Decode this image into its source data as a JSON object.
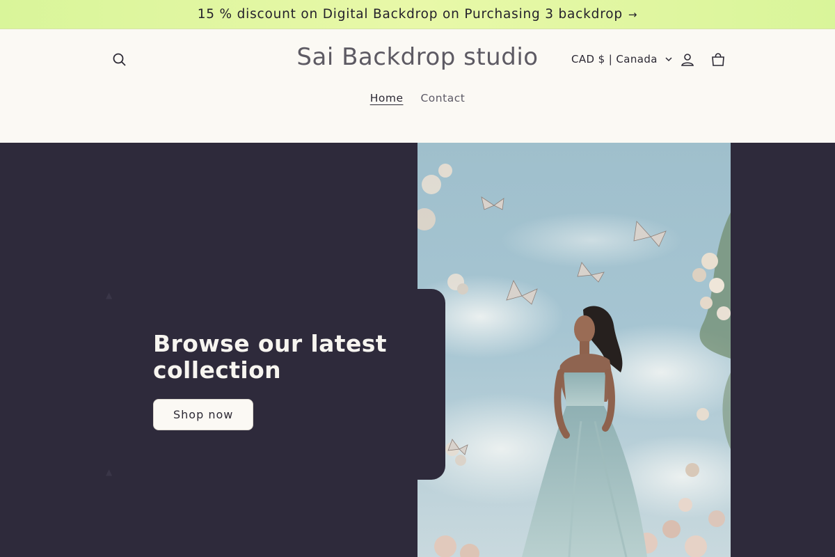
{
  "announcement": {
    "text": "15 % discount on Digital Backdrop on Purchasing 3 backdrop",
    "arrow": "→"
  },
  "header": {
    "store_name": "Sai Backdrop studio",
    "currency_label": "CAD $ | Canada",
    "nav": [
      {
        "label": "Home",
        "active": true
      },
      {
        "label": "Contact",
        "active": false
      }
    ]
  },
  "hero": {
    "title": "Browse our latest collection",
    "button_label": "Shop now"
  },
  "colors": {
    "announcement_bg": "#e3f7a3",
    "header_bg": "#fbf9f4",
    "hero_bg": "#2e2a3b",
    "button_bg": "#fbf9f4"
  },
  "icons": [
    "search-icon",
    "chevron-down-icon",
    "account-icon",
    "cart-icon",
    "arrow-right-icon"
  ]
}
